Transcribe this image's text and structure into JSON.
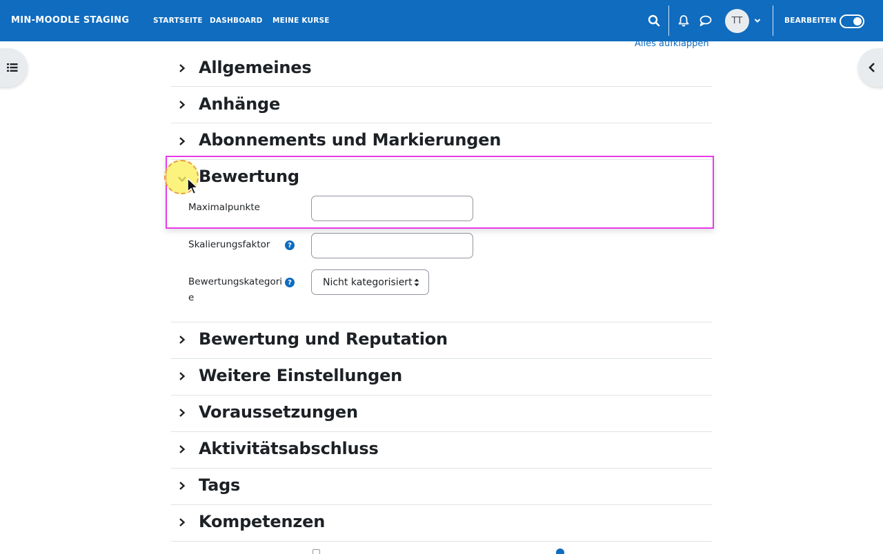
{
  "navbar": {
    "brand": "MIN-MOODLE STAGING",
    "links": [
      "STARTSEITE",
      "DASHBOARD",
      "MEINE KURSE"
    ],
    "avatar_initials": "TT",
    "edit_mode_label": "BEARBEITEN",
    "edit_mode_on": true
  },
  "colors": {
    "primary": "#0f6cbf",
    "highlight": "#e83ae8",
    "click_marker": "#faf05a"
  },
  "content": {
    "expand_all": "Alles aufklappen",
    "sections_top": [
      {
        "title": "Allgemeines",
        "expanded": false
      },
      {
        "title": "Anhänge",
        "expanded": false
      },
      {
        "title": "Abonnements und Markierungen",
        "expanded": false
      }
    ],
    "grading_section": {
      "title": "Bewertung",
      "expanded": true,
      "fields": {
        "max_points_label": "Maximalpunkte",
        "max_points_value": "",
        "scale_factor_label": "Skalierungsfaktor",
        "scale_factor_value": "",
        "category_label_line1": "Bewertungskategori",
        "category_label_line2": "e",
        "category_selected": "Nicht kategorisiert"
      }
    },
    "sections_bottom": [
      {
        "title": "Bewertung und Reputation",
        "expanded": false
      },
      {
        "title": "Weitere Einstellungen",
        "expanded": false
      },
      {
        "title": "Voraussetzungen",
        "expanded": false
      },
      {
        "title": "Aktivitätsabschluss",
        "expanded": false
      },
      {
        "title": "Tags",
        "expanded": false
      },
      {
        "title": "Kompetenzen",
        "expanded": false
      }
    ]
  }
}
